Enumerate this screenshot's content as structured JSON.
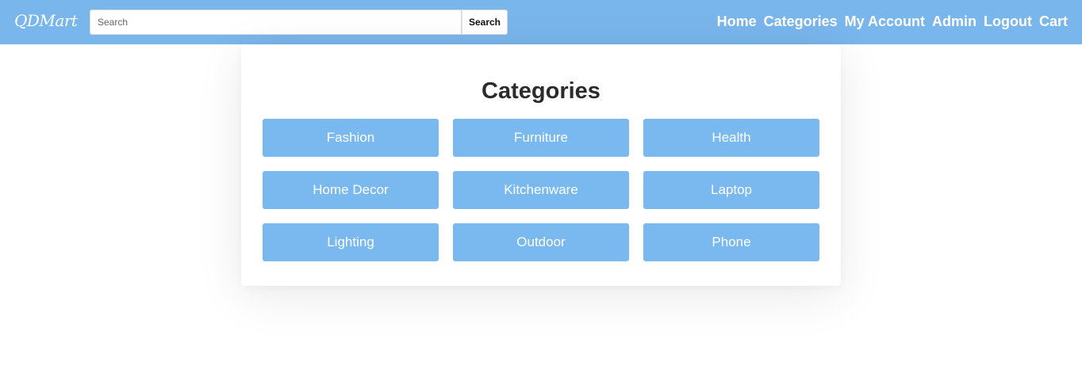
{
  "header": {
    "logo": "QDMart",
    "search": {
      "placeholder": "Search",
      "value": "",
      "button_label": "Search"
    },
    "nav": [
      "Home",
      "Categories",
      "My Account",
      "Admin",
      "Logout",
      "Cart"
    ]
  },
  "main": {
    "title": "Categories",
    "categories": [
      "Fashion",
      "Furniture",
      "Health",
      "Home Decor",
      "Kitchenware",
      "Laptop",
      "Lighting",
      "Outdoor",
      "Phone"
    ]
  },
  "colors": {
    "header_bg": "#79b6ec",
    "category_button_bg": "#79b9ef",
    "text_light": "#ffffff",
    "title_text": "#2b2b2b"
  }
}
